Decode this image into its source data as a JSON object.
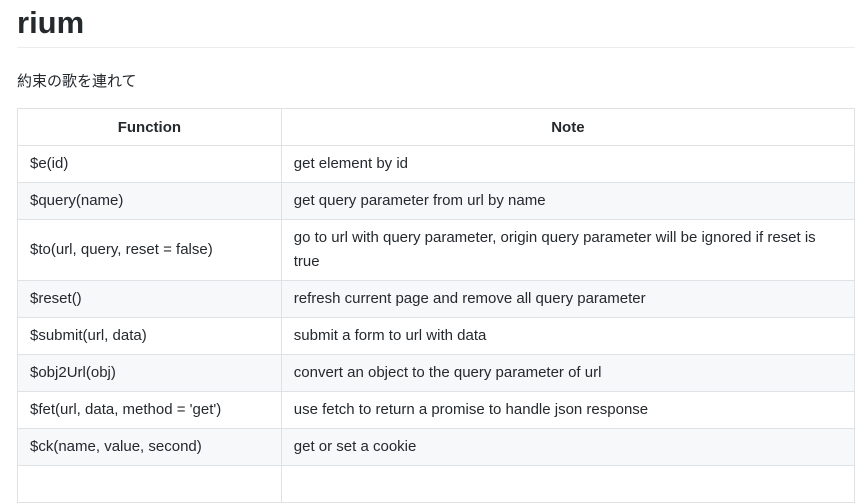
{
  "header": {
    "title": "rium",
    "subtitle": "約束の歌を連れて"
  },
  "table": {
    "columns": [
      "Function",
      "Note"
    ],
    "rows": [
      {
        "function": "$e(id)",
        "note": "get element by id"
      },
      {
        "function": "$query(name)",
        "note": "get query parameter from url by name"
      },
      {
        "function": "$to(url, query, reset = false)",
        "note": "go to url with query parameter, origin query parameter will be ignored if reset is true"
      },
      {
        "function": "$reset()",
        "note": "refresh current page and remove all query parameter"
      },
      {
        "function": "$submit(url, data)",
        "note": "submit a form to url with data"
      },
      {
        "function": "$obj2Url(obj)",
        "note": "convert an object to the query parameter of url"
      },
      {
        "function": "$fet(url, data, method = 'get')",
        "note": "use fetch to return a promise to handle json response"
      },
      {
        "function": "$ck(name, value, second)",
        "note": "get or set a cookie"
      }
    ]
  }
}
